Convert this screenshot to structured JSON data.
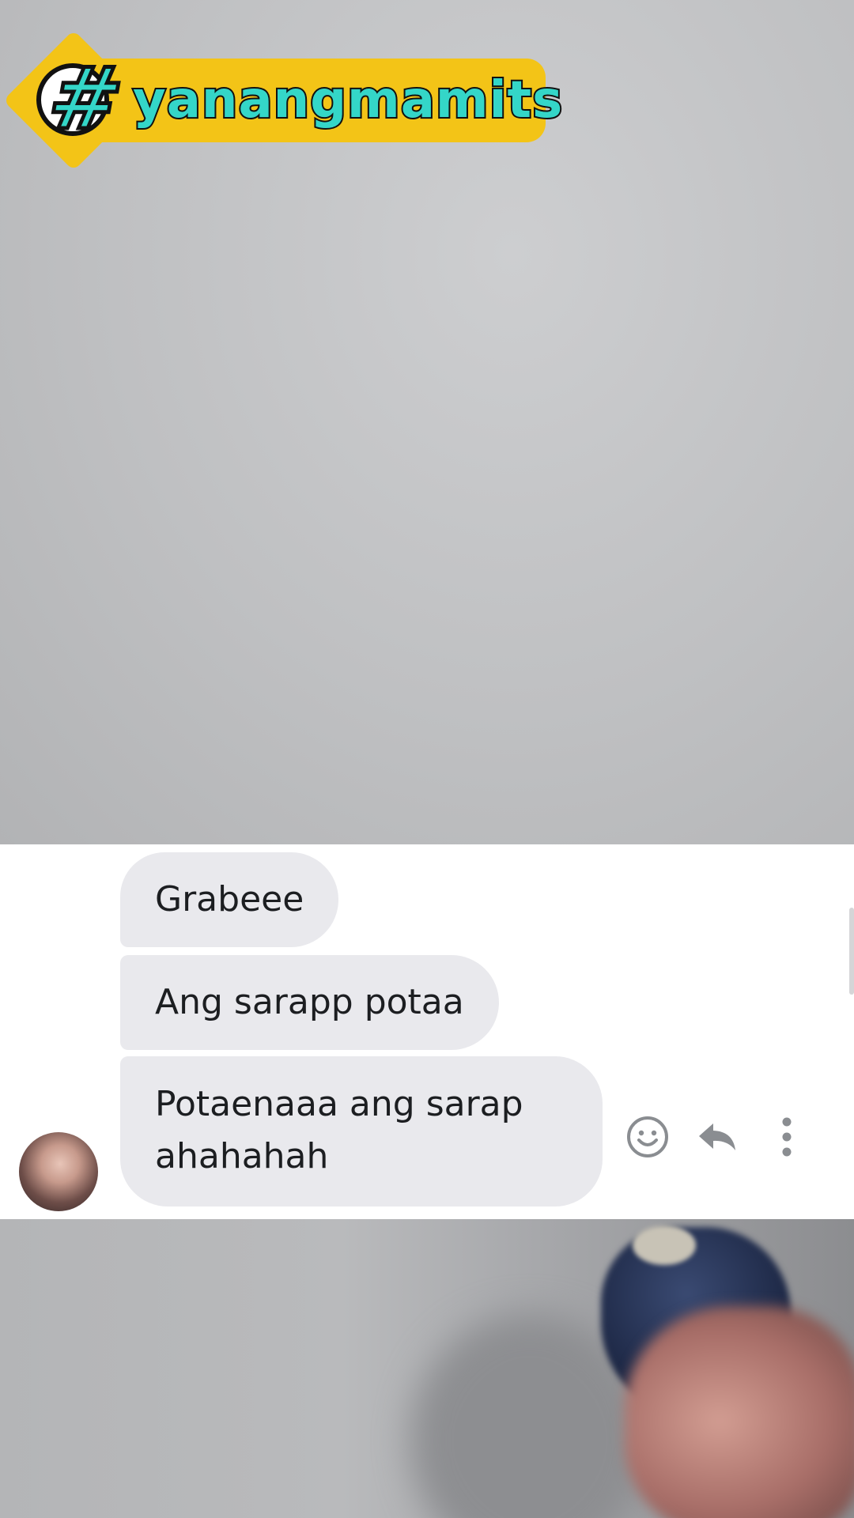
{
  "overlay": {
    "hashtag_symbol": "#",
    "hashtag_text": "yanangmamits"
  },
  "chat": {
    "messages": [
      {
        "text": "Grabeee"
      },
      {
        "text": "Ang sarapp potaa"
      },
      {
        "line1": "Potaenaaa ang sarap",
        "line2": "ahahahah"
      }
    ],
    "actions": [
      {
        "icon": "smiley-icon",
        "label": "React"
      },
      {
        "icon": "reply-icon",
        "label": "Reply"
      },
      {
        "icon": "more-icon",
        "label": "More"
      }
    ]
  },
  "colors": {
    "badge_yellow": "#f3c417",
    "tag_teal": "#34d6c8",
    "bubble_gray": "#e9e9ed",
    "icon_gray": "#8a8d91"
  }
}
